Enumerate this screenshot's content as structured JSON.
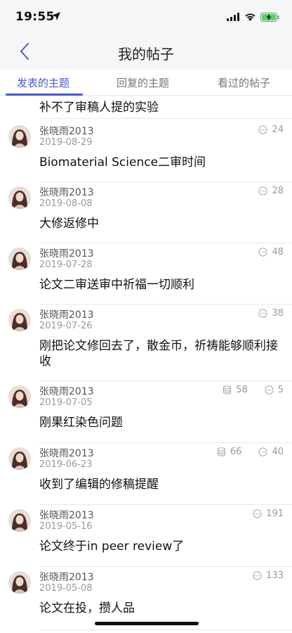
{
  "status": {
    "time": "19:55"
  },
  "nav": {
    "title": "我的帖子"
  },
  "tabs": [
    {
      "label": "发表的主题",
      "active": true
    },
    {
      "label": "回复的主题",
      "active": false
    },
    {
      "label": "看过的帖子",
      "active": false
    }
  ],
  "list": {
    "partial_title": "补不了审稿人提的实验",
    "posts": [
      {
        "author": "张晓雨2013",
        "date": "2019-08-29",
        "title": "Biomaterial Science二审时间",
        "replies": "24",
        "coins": ""
      },
      {
        "author": "张晓雨2013",
        "date": "2019-08-08",
        "title": "大修返修中",
        "replies": "28",
        "coins": ""
      },
      {
        "author": "张晓雨2013",
        "date": "2019-07-28",
        "title": "论文二审送审中祈福一切顺利",
        "replies": "48",
        "coins": ""
      },
      {
        "author": "张晓雨2013",
        "date": "2019-07-26",
        "title": "刚把论文修回去了，散金币，祈祷能够顺利接收",
        "replies": "38",
        "coins": ""
      },
      {
        "author": "张晓雨2013",
        "date": "2019-07-05",
        "title": "刚果红染色问题",
        "replies": "5",
        "coins": "58"
      },
      {
        "author": "张晓雨2013",
        "date": "2019-06-23",
        "title": "收到了编辑的修稿提醒",
        "replies": "40",
        "coins": "66"
      },
      {
        "author": "张晓雨2013",
        "date": "2019-05-16",
        "title": "论文终于in peer review了",
        "replies": "191",
        "coins": ""
      },
      {
        "author": "张晓雨2013",
        "date": "2019-05-08",
        "title": "论文在投，攒人品",
        "replies": "133",
        "coins": ""
      }
    ]
  },
  "colors": {
    "accent": "#4a5ad0",
    "navbar_bg": "#f6f6f6",
    "divider": "#e8e8e8"
  },
  "icons": {
    "back": "chevron-left-icon",
    "reply": "comment-dots-icon",
    "coin": "coin-stack-icon"
  }
}
